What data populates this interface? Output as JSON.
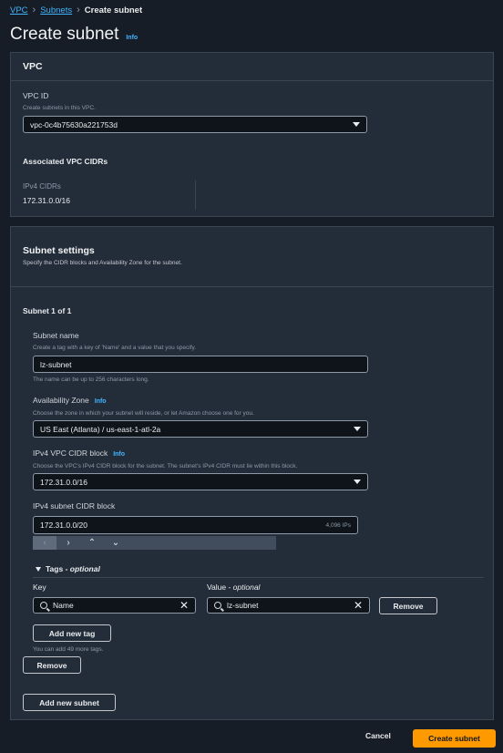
{
  "breadcrumb": {
    "vpc": "VPC",
    "subnets": "Subnets",
    "current": "Create subnet"
  },
  "page": {
    "title": "Create subnet",
    "info": "Info"
  },
  "vpc_panel": {
    "heading": "VPC",
    "vpc_id_label": "VPC ID",
    "vpc_id_desc": "Create subnets in this VPC.",
    "vpc_id_value": "vpc-0c4b75630a221753d",
    "assoc_heading": "Associated VPC CIDRs",
    "ipv4_label": "IPv4 CIDRs",
    "ipv4_value": "172.31.0.0/16"
  },
  "subnet_settings": {
    "heading": "Subnet settings",
    "desc": "Specify the CIDR blocks and Availability Zone for the subnet.",
    "subnet_header": "Subnet 1 of 1",
    "name_label": "Subnet name",
    "name_desc": "Create a tag with a key of 'Name' and a value that you specify.",
    "name_value": "lz-subnet",
    "name_hint": "The name can be up to 256 characters long.",
    "az_label": "Availability Zone",
    "az_info": "Info",
    "az_desc": "Choose the zone in which your subnet will reside, or let Amazon choose one for you.",
    "az_value": "US East (Atlanta) / us-east-1-atl-2a",
    "cidr_label": "IPv4 VPC CIDR block",
    "cidr_info": "Info",
    "cidr_desc": "Choose the VPC's IPv4 CIDR block for the subnet. The subnet's IPv4 CIDR must lie within this block.",
    "cidr_value": "172.31.0.0/16",
    "subnet_cidr_label": "IPv4 subnet CIDR block",
    "subnet_cidr_value": "172.31.0.0/20",
    "subnet_cidr_ips": "4,096 IPs",
    "nav": {
      "prev": "‹",
      "next": "›",
      "up": "⌃",
      "down": "⌄"
    },
    "tags": {
      "toggle_label": "Tags - ",
      "toggle_optional": "optional",
      "key_header": "Key",
      "value_header": "Value - ",
      "value_optional": "optional",
      "key_value": "Name",
      "value_value": "lz-subnet",
      "remove_tag": "Remove",
      "add_tag": "Add new tag",
      "limit_hint": "You can add 49 more tags."
    },
    "remove_subnet": "Remove",
    "add_subnet": "Add new subnet"
  },
  "footer": {
    "cancel": "Cancel",
    "create": "Create subnet"
  }
}
